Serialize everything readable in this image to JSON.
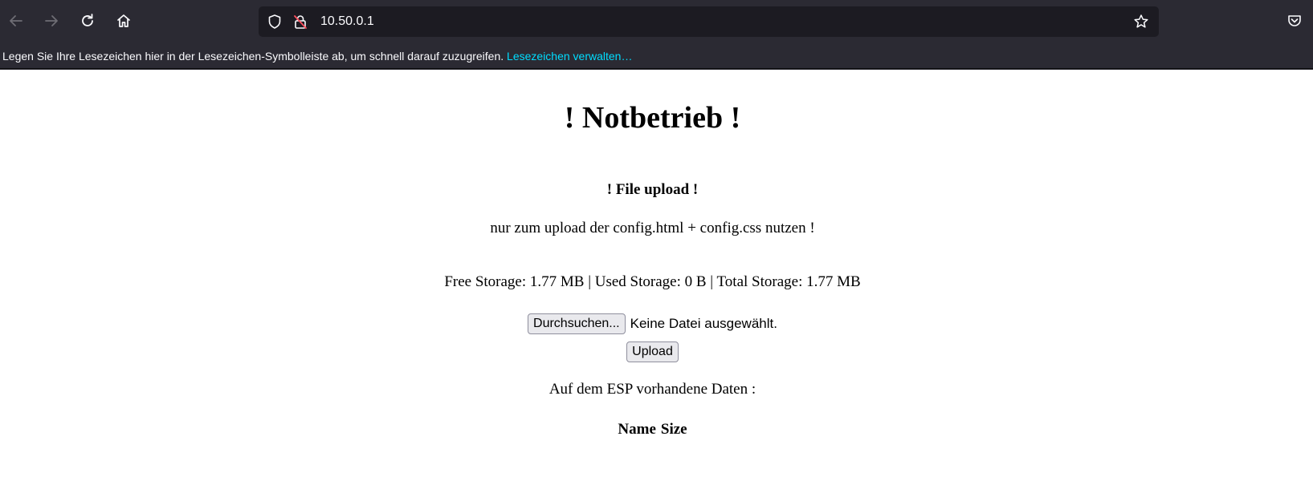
{
  "browser": {
    "url": "10.50.0.1",
    "bookmarks_hint": "Legen Sie Ihre Lesezeichen hier in der Lesezeichen-Symbolleiste ab, um schnell darauf zuzugreifen.",
    "bookmarks_manage": "Lesezeichen verwalten…",
    "icons": [
      "back-icon",
      "forward-icon",
      "reload-icon",
      "home-icon",
      "shield-icon",
      "insecure-lock-icon",
      "bookmark-star-icon",
      "pocket-icon"
    ]
  },
  "page": {
    "title": "! Notbetrieb !",
    "subtitle": "! File upload !",
    "note": "nur zum upload der config.html + config.css nutzen !",
    "storage": "Free Storage: 1.77 MB | Used Storage: 0 B | Total Storage: 1.77 MB",
    "browse_label": "Durchsuchen...",
    "no_file_label": "Keine Datei ausgewählt.",
    "upload_label": "Upload",
    "data_title": "Auf dem ESP vorhandene Daten :",
    "table_headers": [
      "Name",
      "Size"
    ]
  },
  "colors": {
    "chrome_bg": "#2b2a33",
    "urlbar_bg": "#1c1b22",
    "link": "#00ddff",
    "page_bg": "#ffffff"
  }
}
